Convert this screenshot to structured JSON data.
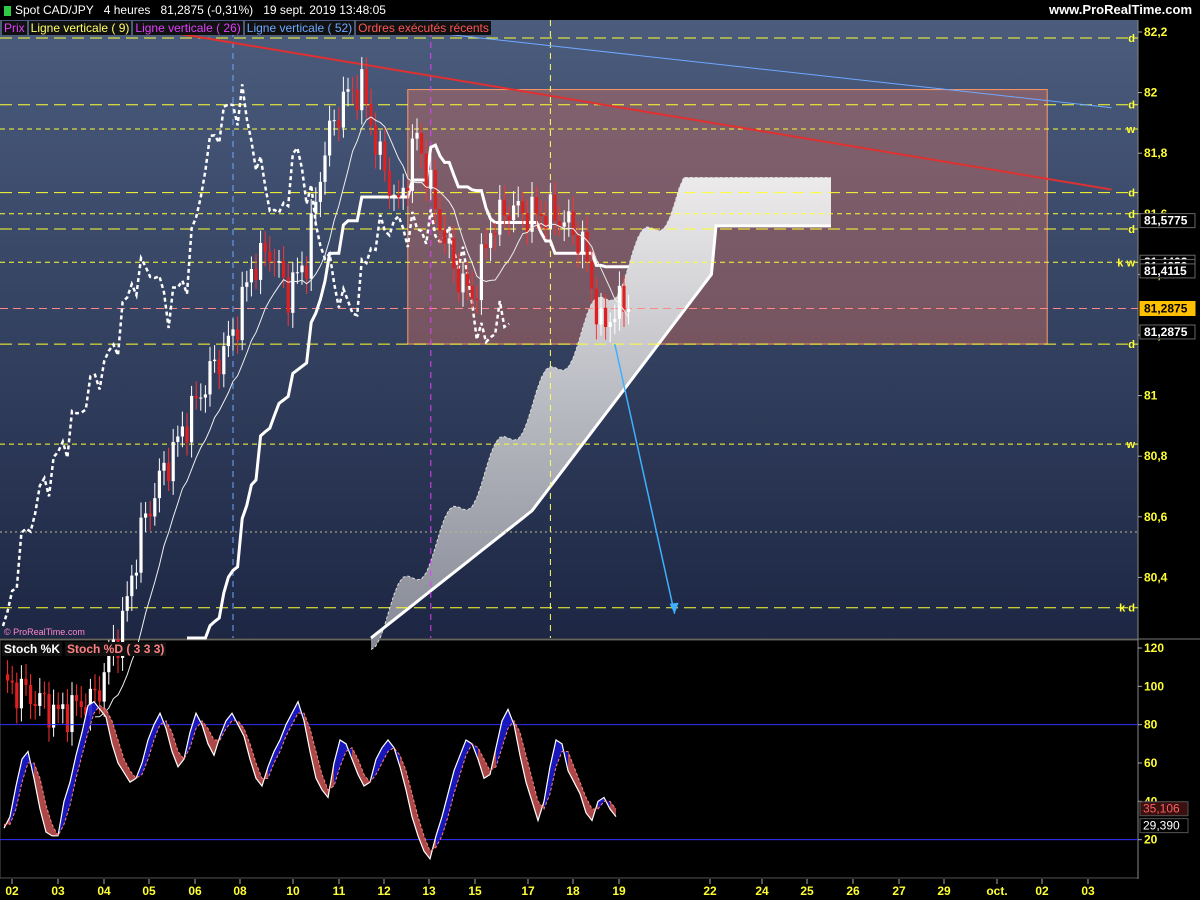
{
  "header": {
    "title": "Spot CAD/JPY",
    "timeframe": "4 heures",
    "price_change": "81,2875 (-0,31%)",
    "datetime": "19 sept. 2019 13:48:05",
    "site": "www.ProRealTime.com"
  },
  "legend": [
    {
      "label": "Prix",
      "color": "#e040fb"
    },
    {
      "label": "Ligne verticale ( 9)",
      "color": "#ffff66"
    },
    {
      "label": "Ligne verticale ( 26)",
      "color": "#e040fb"
    },
    {
      "label": "Ligne verticale ( 52)",
      "color": "#6ea8ff"
    },
    {
      "label": "Ordres exécutés récents",
      "color": "#ff5555"
    }
  ],
  "credit": "© ProRealTime.com",
  "stoch_legend": [
    {
      "label": "Stoch %K",
      "color": "#ffffff"
    },
    {
      "label": "Stoch %D ( 3 3 3)",
      "color": "#ff8080"
    }
  ],
  "chart_data": [
    {
      "type": "candlestick",
      "symbol": "Spot CAD/JPY",
      "ylim": [
        80.2,
        82.2
      ],
      "y_ticks": [
        "82,2",
        "82",
        "81,8",
        "81,6",
        "81,4",
        "81,2",
        "81",
        "80,8",
        "80,6",
        "80,4"
      ],
      "x_ticks": [
        "02",
        "03",
        "04",
        "05",
        "06",
        "08",
        "10",
        "11",
        "12",
        "13",
        "15",
        "17",
        "18",
        "19",
        "22",
        "24",
        "25",
        "26",
        "27",
        "29",
        "oct.",
        "02",
        "03"
      ],
      "price_labels": [
        {
          "text": "81,5775",
          "value": 81.5775,
          "bg": "#000000",
          "fg": "#ffffff"
        },
        {
          "text": "81,4402",
          "value": 81.4402,
          "bg": "#000000",
          "fg": "#ffffff"
        },
        {
          "text": "81,4259",
          "value": 81.4259,
          "bg": "#000000",
          "fg": "#ffffff"
        },
        {
          "text": "81,4115",
          "value": 81.4115,
          "bg": "#000000",
          "fg": "#ffffff"
        },
        {
          "text": "81,2875",
          "value": 81.2875,
          "bg": "#ffc000",
          "fg": "#000000"
        },
        {
          "text": "81,2875",
          "value": 81.21,
          "bg": "#000000",
          "fg": "#ffffff"
        }
      ],
      "level_lines": [
        {
          "value": 82.18,
          "tag": "d",
          "style": "long-dash"
        },
        {
          "value": 81.96,
          "tag": "d",
          "style": "long-dash"
        },
        {
          "value": 81.88,
          "tag": "w",
          "style": "short-dash"
        },
        {
          "value": 81.67,
          "tag": "d",
          "style": "long-dash"
        },
        {
          "value": 81.6,
          "tag": "d",
          "style": "short-dash"
        },
        {
          "value": 81.55,
          "tag": "d",
          "style": "long-dash"
        },
        {
          "value": 81.44,
          "tag": "k w",
          "style": "short-dash"
        },
        {
          "value": 81.17,
          "tag": "d",
          "style": "long-dash"
        },
        {
          "value": 80.84,
          "tag": "w",
          "style": "short-dash"
        },
        {
          "value": 80.55,
          "tag": "",
          "style": "fine-dot"
        },
        {
          "value": 80.3,
          "tag": "k d",
          "style": "long-dash"
        }
      ],
      "vertical_markers": [
        {
          "bar": 50,
          "label": "Ligne verticale ( 52)",
          "color": "#6ea8ff"
        },
        {
          "bar": 93,
          "label": "Ligne verticale ( 26)",
          "color": "#e040fb"
        },
        {
          "bar": 119,
          "label": "Ligne verticale ( 9)",
          "color": "#ffff66"
        }
      ],
      "zone": {
        "bar_from": 88,
        "bar_to": 227,
        "y_from": 81.17,
        "y_to": 82.01
      },
      "trendlines": [
        {
          "from": [
            36,
            82.2
          ],
          "to": [
            241,
            81.68
          ],
          "color": "#e03030"
        },
        {
          "from": [
            92,
            82.2
          ],
          "to": [
            241,
            81.95
          ],
          "color": "#6ea8ff"
        }
      ],
      "arrow": {
        "from": [
          133,
          81.17
        ],
        "to": [
          146,
          80.28
        ],
        "color": "#3fb0ff"
      },
      "current_price": 81.2875,
      "current_dash_line": 81.2875
    },
    {
      "type": "line",
      "title": "Stoch",
      "ylim": [
        0,
        120
      ],
      "y_ticks": [
        "120",
        "100",
        "80",
        "60",
        "40",
        "20"
      ],
      "levels": [
        80,
        20
      ],
      "series": [
        {
          "name": "Stoch %K",
          "values": [
            26,
            32,
            48,
            62,
            66,
            52,
            36,
            24,
            22,
            22,
            40,
            50,
            64,
            76,
            90,
            92,
            88,
            84,
            70,
            60,
            55,
            50,
            52,
            60,
            72,
            80,
            86,
            78,
            66,
            58,
            62,
            76,
            86,
            80,
            70,
            64,
            74,
            82,
            86,
            80,
            74,
            62,
            52,
            48,
            58,
            66,
            72,
            80,
            86,
            92,
            82,
            66,
            52,
            46,
            42,
            60,
            72,
            70,
            62,
            54,
            48,
            50,
            62,
            68,
            72,
            68,
            58,
            46,
            32,
            22,
            14,
            10,
            22,
            32,
            44,
            56,
            64,
            72,
            70,
            62,
            52,
            54,
            68,
            82,
            88,
            80,
            64,
            50,
            40,
            30,
            40,
            58,
            72,
            70,
            56,
            50,
            44,
            34,
            30,
            40,
            42,
            36,
            32
          ]
        },
        {
          "name": "Stoch %D ( 3 3 3)",
          "values": [
            28,
            28,
            36,
            50,
            60,
            60,
            52,
            38,
            28,
            22,
            28,
            38,
            52,
            64,
            76,
            86,
            90,
            88,
            82,
            72,
            62,
            56,
            52,
            54,
            62,
            72,
            80,
            82,
            76,
            66,
            62,
            68,
            78,
            82,
            78,
            72,
            72,
            78,
            82,
            82,
            78,
            70,
            60,
            52,
            52,
            60,
            66,
            74,
            80,
            86,
            86,
            78,
            66,
            54,
            46,
            48,
            58,
            66,
            68,
            62,
            54,
            50,
            54,
            60,
            66,
            68,
            64,
            56,
            44,
            32,
            22,
            14,
            16,
            22,
            32,
            44,
            54,
            64,
            70,
            68,
            62,
            56,
            58,
            68,
            78,
            82,
            76,
            64,
            52,
            40,
            36,
            44,
            58,
            66,
            66,
            58,
            50,
            42,
            36,
            36,
            40,
            40,
            36
          ]
        }
      ],
      "last_labels": [
        {
          "text": "35,106",
          "bg": "#3a1010",
          "fg": "#ff6060"
        },
        {
          "text": "29,390",
          "bg": "#000000",
          "fg": "#ffffff"
        }
      ]
    }
  ]
}
